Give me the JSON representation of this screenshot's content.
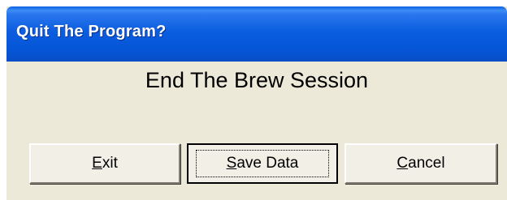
{
  "dialog": {
    "title": "Quit The Program?",
    "message": "End The Brew Session",
    "buttons": {
      "exit": {
        "accel": "E",
        "rest": "xit"
      },
      "save": {
        "accel": "S",
        "rest": "ave Data"
      },
      "cancel": {
        "accel": "C",
        "rest": "ancel"
      }
    },
    "focused_button": "save"
  },
  "colors": {
    "titlebar": "#0555d6",
    "dialog_face": "#ece9d8",
    "title_text": "#ffffff"
  }
}
